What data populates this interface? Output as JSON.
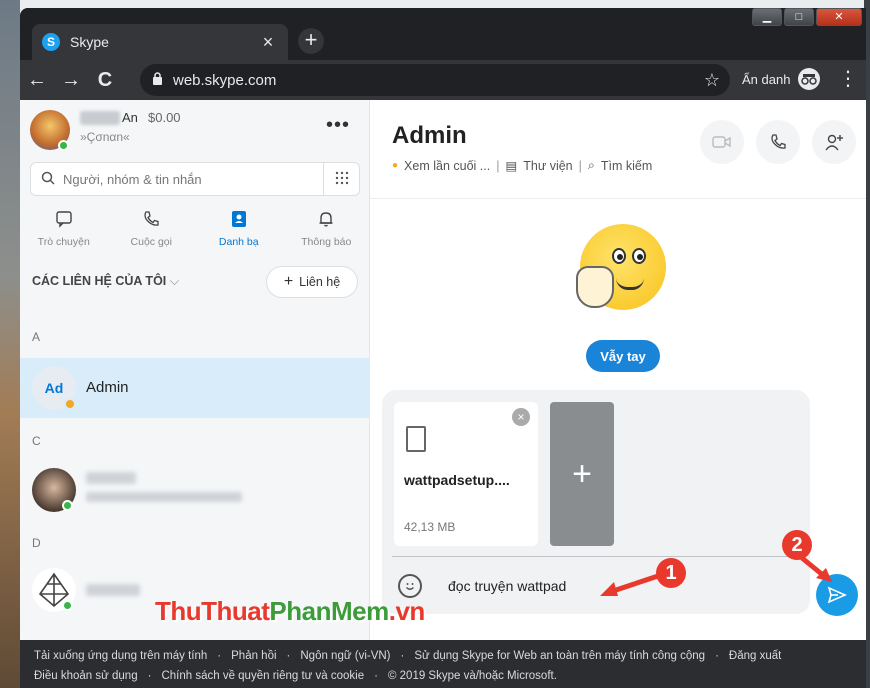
{
  "window": {
    "minimize": "▁",
    "maximize": "□",
    "close": "✕"
  },
  "tab": {
    "title": "Skype",
    "icon": "S",
    "close": "×",
    "new_tab": "+"
  },
  "toolbar": {
    "back": "←",
    "forward": "→",
    "reload": "C",
    "lock": "🔒",
    "url": "web.skype.com",
    "star": "☆",
    "incognito_label": "Ẩn danh",
    "menu": "⋮"
  },
  "profile": {
    "name": "An",
    "credit": "$0.00",
    "mood": "»Çσnαn«",
    "more": "•••"
  },
  "search": {
    "placeholder": "Người, nhóm & tin nhắn"
  },
  "nav_tabs": [
    {
      "label": "Trò chuyện",
      "icon": "chat-icon"
    },
    {
      "label": "Cuộc gọi",
      "icon": "phone-icon"
    },
    {
      "label": "Danh bạ",
      "icon": "contacts-icon",
      "active": true
    },
    {
      "label": "Thông báo",
      "icon": "bell-icon"
    }
  ],
  "contacts": {
    "header": "CÁC LIÊN HỆ CỦA TÔI",
    "add_label": "Liên hệ",
    "groups": [
      {
        "letter": "A",
        "items": [
          {
            "initials": "Ad",
            "name": "Admin"
          }
        ]
      },
      {
        "letter": "C"
      },
      {
        "letter": "D"
      }
    ]
  },
  "chat": {
    "title": "Admin",
    "last_seen": "Xem lần cuối ...",
    "library": "Thư viện",
    "search": "Tìm kiếm",
    "wave_label": "Vẫy tay",
    "attachment": {
      "name": "wattpadsetup....",
      "size": "42,13 MB"
    },
    "message": "đọc truyện wattpad"
  },
  "annotations": [
    "1",
    "2"
  ],
  "footer": {
    "row1": [
      "Tải xuống ứng dụng trên máy tính",
      "Phản hồi",
      "Ngôn ngữ (vi-VN)",
      "Sử dụng Skype for Web an toàn trên máy tính công cộng",
      "Đăng xuất"
    ],
    "row2": [
      "Điều khoản sử dụng",
      "Chính sách về quyền riêng tư và cookie",
      "© 2019 Skype và/hoặc Microsoft."
    ]
  },
  "watermark": {
    "part1": "ThuThuat",
    "part2": "PhanMem",
    "part3": ".vn"
  },
  "colors": {
    "accent": "#0078d4",
    "send": "#1a9be6",
    "annotation": "#e8392c",
    "online": "#3ab54a"
  }
}
